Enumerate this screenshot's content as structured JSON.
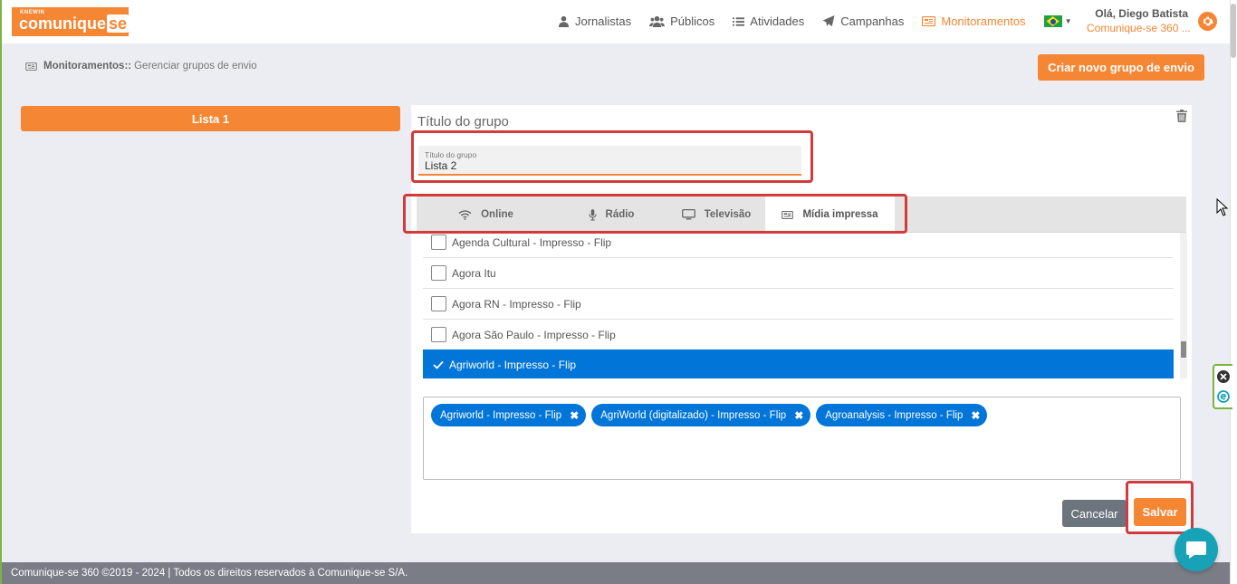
{
  "logo": {
    "brand_small": "KNEWIN",
    "brand_main": "comunique",
    "brand_suffix": "se"
  },
  "nav": [
    {
      "label": "Jornalistas",
      "icon": "user-icon"
    },
    {
      "label": "Públicos",
      "icon": "users-icon"
    },
    {
      "label": "Atividades",
      "icon": "list-icon"
    },
    {
      "label": "Campanhas",
      "icon": "paper-plane-icon"
    },
    {
      "label": "Monitoramentos",
      "icon": "newspaper-icon",
      "active": true
    }
  ],
  "user": {
    "greeting": "Olá, Diego Batista",
    "org": "Comunique-se 360 ..."
  },
  "breadcrumb": {
    "section": "Monitoramentos::",
    "page": "Gerenciar grupos de envio"
  },
  "actions": {
    "create_group": "Criar novo grupo de envio"
  },
  "sidebar": {
    "lists": [
      {
        "label": "Lista 1"
      }
    ]
  },
  "panel": {
    "title": "Título do grupo",
    "field": {
      "label": "Título do grupo",
      "value": "Lista 2"
    },
    "tabs": [
      {
        "label": "Online",
        "icon": "wifi-icon"
      },
      {
        "label": "Rádio",
        "icon": "microphone-icon"
      },
      {
        "label": "Televisão",
        "icon": "tv-icon"
      },
      {
        "label": "Mídia impressa",
        "icon": "newspaper-icon",
        "active": true
      }
    ],
    "media": [
      {
        "label": "Agenda Cultural - Impresso - Flip",
        "checked": false
      },
      {
        "label": "Agora Itu",
        "checked": false
      },
      {
        "label": "Agora RN - Impresso - Flip",
        "checked": false
      },
      {
        "label": "Agora São Paulo - Impresso - Flip",
        "checked": false
      },
      {
        "label": "Agriworld - Impresso - Flip",
        "checked": true
      }
    ],
    "selected": [
      {
        "label": "Agriworld - Impresso - Flip"
      },
      {
        "label": "AgriWorld (digitalizado) - Impresso - Flip"
      },
      {
        "label": "Agroanalysis - Impresso - Flip"
      }
    ],
    "cancel": "Cancelar",
    "save": "Salvar"
  },
  "footer": {
    "text": "Comunique-se 360 ©2019 - 2024 | Todos os direitos reservados à Comunique-se S/A."
  },
  "colors": {
    "brand": "#f58634",
    "selected": "#0275d8",
    "highlight": "#d23b3b"
  }
}
